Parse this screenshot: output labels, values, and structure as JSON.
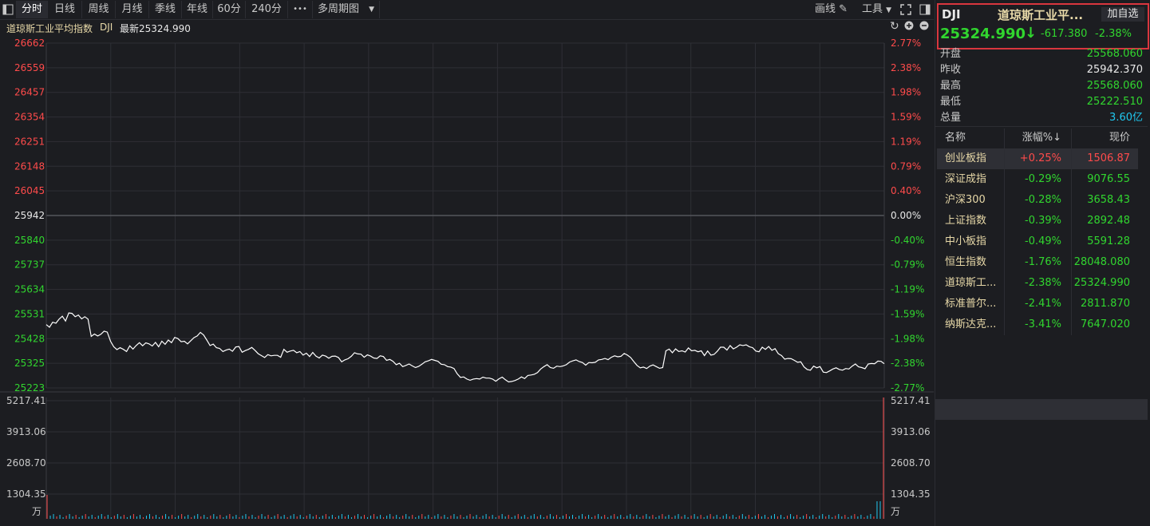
{
  "toolbar": {
    "tabs": [
      "分时",
      "日线",
      "周线",
      "月线",
      "季线",
      "年线",
      "60分",
      "240分"
    ],
    "more": "•••",
    "multi_period": "多周期图",
    "draw_label": "画线",
    "tools_label": "工具"
  },
  "chart_header": {
    "name": "道琼斯工业平均指数",
    "code": "DJI",
    "latest": "最新25324.990"
  },
  "chart_data": {
    "type": "line",
    "prev_close": 25942,
    "ylim": [
      25223,
      26662
    ],
    "left_ticks": [
      "26662",
      "26559",
      "26457",
      "26354",
      "26251",
      "26148",
      "26045",
      "25942",
      "25840",
      "25737",
      "25634",
      "25531",
      "25428",
      "25325",
      "25223"
    ],
    "right_ticks": [
      "2.77%",
      "2.38%",
      "1.98%",
      "1.59%",
      "1.19%",
      "0.79%",
      "0.40%",
      "0.00%",
      "-0.40%",
      "-0.79%",
      "-1.19%",
      "-1.59%",
      "-1.98%",
      "-2.38%",
      "-2.77%"
    ],
    "series": [
      {
        "values": [
          25487,
          25476,
          25497,
          25493,
          25510,
          25522,
          25502,
          25536,
          25534,
          25520,
          25527,
          25511,
          25520,
          25510,
          25438,
          25448,
          25440,
          25447,
          25460,
          25456,
          25418,
          25395,
          25383,
          25391,
          25384,
          25375,
          25399,
          25385,
          25400,
          25412,
          25399,
          25411,
          25407,
          25398,
          25413,
          25395,
          25418,
          25405,
          25423,
          25412,
          25434,
          25429,
          25416,
          25418,
          25407,
          25420,
          25433,
          25440,
          25455,
          25444,
          25423,
          25400,
          25406,
          25391,
          25388,
          25375,
          25381,
          25385,
          25376,
          25394,
          25396,
          25372,
          25379,
          25384,
          25392,
          25380,
          25366,
          25358,
          25350,
          25362,
          25357,
          25359,
          25359,
          25351,
          25384,
          25372,
          25377,
          25380,
          25370,
          25375,
          25360,
          25368,
          25354,
          25371,
          25356,
          25348,
          25360,
          25356,
          25347,
          25355,
          25356,
          25350,
          25332,
          25340,
          25345,
          25355,
          25370,
          25365,
          25364,
          25351,
          25361,
          25356,
          25348,
          25346,
          25357,
          25354,
          25338,
          25342,
          25334,
          25320,
          25326,
          25312,
          25317,
          25323,
          25315,
          25308,
          25313,
          25322,
          25332,
          25336,
          25342,
          25338,
          25334,
          25322,
          25320,
          25312,
          25310,
          25304,
          25282,
          25267,
          25269,
          25260,
          25255,
          25260,
          25262,
          25260,
          25268,
          25264,
          25264,
          25260,
          25251,
          25261,
          25268,
          25257,
          25248,
          25250,
          25254,
          25260,
          25269,
          25262,
          25275,
          25277,
          25280,
          25287,
          25302,
          25312,
          25320,
          25308,
          25305,
          25314,
          25312,
          25315,
          25320,
          25331,
          25336,
          25340,
          25333,
          25329,
          25318,
          25329,
          25328,
          25330,
          25340,
          25342,
          25346,
          25341,
          25351,
          25357,
          25353,
          25355,
          25367,
          25360,
          25350,
          25333,
          25317,
          25307,
          25310,
          25304,
          25314,
          25319,
          25312,
          25305,
          25308,
          25378,
          25385,
          25370,
          25386,
          25375,
          25378,
          25373,
          25390,
          25378,
          25380,
          25374,
          25378,
          25358,
          25377,
          25360,
          25363,
          25376,
          25393,
          25393,
          25381,
          25400,
          25386,
          25393,
          25403,
          25400,
          25403,
          25395,
          25391,
          25377,
          25374,
          25393,
          25384,
          25396,
          25380,
          25387,
          25366,
          25358,
          25343,
          25346,
          25345,
          25338,
          25330,
          25332,
          25311,
          25300,
          25297,
          25314,
          25307,
          25312,
          25289,
          25287,
          25294,
          25302,
          25307,
          25300,
          25297,
          25304,
          25302,
          25314,
          25323,
          25311,
          25308,
          25303,
          25323,
          25325,
          25324,
          25335,
          25334,
          25324
        ]
      }
    ]
  },
  "vol_chart": {
    "left_ticks": [
      "5217.41",
      "3913.06",
      "2608.70",
      "1304.35"
    ],
    "right_ticks": [
      "5217.41",
      "3913.06",
      "2608.70",
      "1304.35"
    ],
    "unit": "万"
  },
  "quote": {
    "code": "DJI",
    "name": "道琼斯工业平...",
    "add_btn": "加自选",
    "price": "25324.990",
    "arrow": "↓",
    "change": "-617.380",
    "pct": "-2.38%"
  },
  "stats": [
    {
      "label": "开盘",
      "value": "25568.060",
      "color": "#31d62f"
    },
    {
      "label": "昨收",
      "value": "25942.370",
      "color": "#e8e8e8"
    },
    {
      "label": "最高",
      "value": "25568.060",
      "color": "#31d62f"
    },
    {
      "label": "最低",
      "value": "25222.510",
      "color": "#31d62f"
    },
    {
      "label": "总量",
      "value": "3.60亿",
      "color": "#20c8f0"
    }
  ],
  "rank": {
    "headers": [
      "名称",
      "涨幅%↓",
      "现价"
    ],
    "rows": [
      {
        "name": "创业板指",
        "pct": "+0.25%",
        "price": "1506.87",
        "up": true
      },
      {
        "name": "深证成指",
        "pct": "-0.29%",
        "price": "9076.55",
        "up": false
      },
      {
        "name": "沪深300",
        "pct": "-0.28%",
        "price": "3658.43",
        "up": false
      },
      {
        "name": "上证指数",
        "pct": "-0.39%",
        "price": "2892.48",
        "up": false
      },
      {
        "name": "中小板指",
        "pct": "-0.49%",
        "price": "5591.28",
        "up": false
      },
      {
        "name": "恒生指数",
        "pct": "-1.76%",
        "price": "28048.080",
        "up": false
      },
      {
        "name": "道琼斯工...",
        "pct": "-2.38%",
        "price": "25324.990",
        "up": false
      },
      {
        "name": "标准普尔...",
        "pct": "-2.41%",
        "price": "2811.870",
        "up": false
      },
      {
        "name": "纳斯达克...",
        "pct": "-3.41%",
        "price": "7647.020",
        "up": false
      }
    ]
  }
}
